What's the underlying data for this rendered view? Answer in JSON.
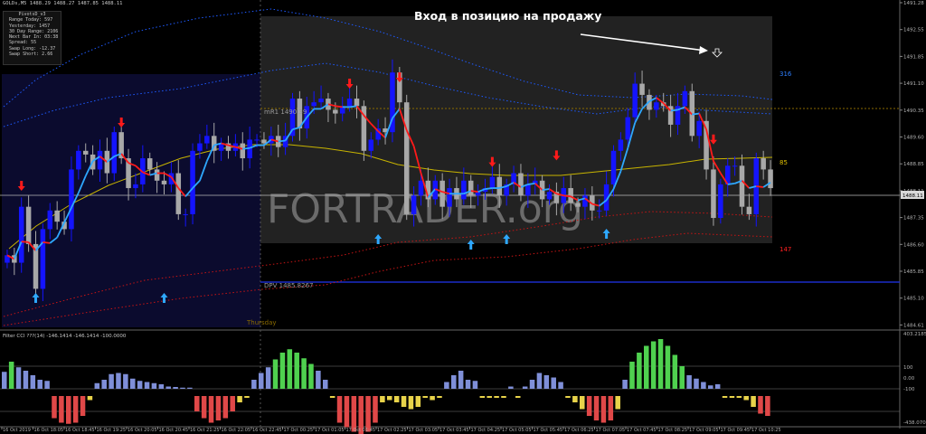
{
  "window_title": "GOLDs,M5  1488.29 1488.27 1487.85 1488.11",
  "headline": "Вход в позицию на продажу",
  "watermark": "FORTRADER.org",
  "info_panel": {
    "title": "PivotsD_v3",
    "rows": [
      {
        "label": "Range Today:",
        "value": "597"
      },
      {
        "label": "Yesterday:",
        "value": "1457"
      },
      {
        "label": "30 Day Range:",
        "value": "2106"
      },
      {
        "label": "Next Bar In:",
        "value": "03:38"
      },
      {
        "label": "Spread:",
        "value": "55"
      },
      {
        "label": "Swap Long:",
        "value": "-12.37"
      },
      {
        "label": "Swap Short:",
        "value": "2.66"
      }
    ]
  },
  "level_labels": {
    "mr1": "mR1  1490.39",
    "dpv": "DPV  1485.8267",
    "day": "Thursday",
    "upper_band": "316",
    "mid_band": "85",
    "lower_band": "147"
  },
  "colors": {
    "bull_candle": "#1414ff",
    "bear_candle": "#a8a8a8",
    "trail_up": "#2ea8ff",
    "trail_down": "#ff1a1a",
    "ma_yellow": "#c8b400",
    "band_blue": "#1e5aff",
    "band_red": "#c81414",
    "buy_arrow": "#2ea8ff",
    "sell_arrow": "#ff1a1a",
    "cci_green": "#4fd14f",
    "cci_blue": "#7f8fd8",
    "cci_yellow": "#e8d34a",
    "cci_red": "#e04848",
    "shade_blue": "#0b0b2e",
    "shade_gray": "#222222"
  },
  "price_axis": {
    "ticks": [
      "1491.28",
      "1492.55",
      "1491.85",
      "1491.10",
      "1490.35",
      "1489.60",
      "1488.85",
      "1488.11",
      "1487.35",
      "1486.60",
      "1485.85",
      "1485.10",
      "1484.61"
    ],
    "current_price": "1488.11"
  },
  "time_axis": {
    "ticks": [
      "16 Oct 2019",
      "16 Oct 18:05",
      "16 Oct 18:45",
      "16 Oct 19:25",
      "16 Oct 20:05",
      "16 Oct 20:45",
      "16 Oct 21:25",
      "16 Oct 22:05",
      "16 Oct 22:45",
      "17 Oct 00:25",
      "17 Oct 01:05",
      "17 Oct 01:45",
      "17 Oct 02:25",
      "17 Oct 03:05",
      "17 Oct 03:45",
      "17 Oct 04:25",
      "17 Oct 05:05",
      "17 Oct 05:45",
      "17 Oct 06:25",
      "17 Oct 07:05",
      "17 Oct 07:45",
      "17 Oct 08:25",
      "17 Oct 09:05",
      "17 Oct 09:45",
      "17 Oct 10:25"
    ]
  },
  "indicator": {
    "title": "Filter CCI ???(14)  -146.1414 -146.1414 -100.0000",
    "ticks": [
      "403.2185",
      "100",
      "0.00",
      "-100",
      "-438.07031"
    ],
    "levels": [
      100,
      0,
      -100
    ]
  },
  "chart_data": [
    {
      "type": "candlestick",
      "title": "GOLDs,M5",
      "ylim": [
        1484.61,
        1493.28
      ],
      "candle_count": 108,
      "closes": [
        1486.3,
        1486.1,
        1487.6,
        1486.6,
        1485.4,
        1487.0,
        1487.5,
        1487.2,
        1487.0,
        1488.6,
        1489.1,
        1489.0,
        1488.6,
        1489.1,
        1488.5,
        1489.6,
        1488.9,
        1488.1,
        1488.2,
        1488.9,
        1488.6,
        1488.3,
        1488.2,
        1488.5,
        1487.4,
        1487.4,
        1489.1,
        1489.3,
        1489.5,
        1489.1,
        1489.3,
        1489.1,
        1489.3,
        1488.9,
        1489.4,
        1489.4,
        1489.3,
        1489.5,
        1489.2,
        1489.5,
        1490.5,
        1489.7,
        1490.3,
        1490.4,
        1490.5,
        1490.2,
        1490.1,
        1490.3,
        1490.5,
        1490.3,
        1489.1,
        1489.4,
        1489.7,
        1489.6,
        1491.2,
        1490.4,
        1487.4,
        1487.9,
        1488.3,
        1487.8,
        1488.3,
        1487.6,
        1488.1,
        1487.8,
        1488.3,
        1487.9,
        1488.0,
        1488.1,
        1488.4,
        1487.9,
        1488.2,
        1488.5,
        1487.9,
        1488.2,
        1488.3,
        1487.8,
        1488.0,
        1487.7,
        1488.1,
        1487.7,
        1487.6,
        1487.9,
        1487.5,
        1487.5,
        1488.2,
        1489.1,
        1489.4,
        1490.0,
        1490.9,
        1490.6,
        1490.2,
        1490.4,
        1490.3,
        1489.8,
        1490.3,
        1490.7,
        1489.5,
        1489.9,
        1488.6,
        1487.3,
        1488.2,
        1488.7,
        1488.7,
        1487.6,
        1487.4,
        1488.9,
        1488.6,
        1488.1
      ],
      "buy_signal_bars": [
        4,
        22,
        52,
        65,
        70,
        84
      ],
      "sell_signal_bars": [
        2,
        16,
        48,
        55,
        68,
        77,
        99
      ],
      "levels": {
        "mR1": 1490.39,
        "DPV": 1485.8267
      }
    },
    {
      "type": "bar",
      "title": "Filter CCI ???(14)",
      "ylim": [
        -438.07031,
        403.2185
      ],
      "values": [
        75,
        120,
        95,
        80,
        60,
        40,
        35,
        -130,
        -150,
        -155,
        -150,
        -120,
        -50,
        25,
        40,
        65,
        70,
        65,
        45,
        35,
        30,
        25,
        20,
        10,
        8,
        5,
        5,
        -100,
        -130,
        -150,
        -140,
        -130,
        -100,
        -60,
        -20,
        40,
        70,
        95,
        130,
        160,
        175,
        160,
        135,
        110,
        80,
        40,
        -30,
        -150,
        -170,
        -190,
        -200,
        -190,
        -150,
        -60,
        -50,
        -60,
        -80,
        -90,
        -80,
        -40,
        -50,
        -30,
        30,
        60,
        80,
        40,
        35,
        -20,
        -40,
        -40,
        -35,
        10,
        -10,
        10,
        40,
        70,
        60,
        50,
        30,
        -15,
        -60,
        -90,
        -120,
        -140,
        -150,
        -140,
        -90,
        40,
        120,
        160,
        190,
        210,
        220,
        190,
        150,
        100,
        60,
        45,
        30,
        15,
        20,
        -10,
        -20,
        -20,
        -50,
        -80,
        -110,
        -120
      ]
    }
  ]
}
